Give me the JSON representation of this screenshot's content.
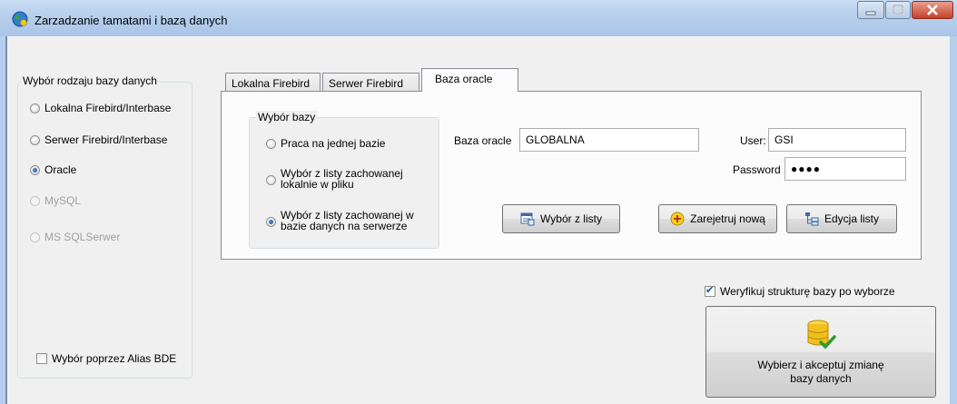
{
  "window": {
    "title": "Zarzadzanie tamatami i bazą danych",
    "controls": {
      "minimize": "minimize-icon",
      "maximize": "maximize-icon",
      "close": "close-icon"
    }
  },
  "db_type": {
    "group_title": "Wybór rodzaju bazy danych",
    "options": [
      {
        "label": "Lokalna Firebird/Interbase",
        "checked": false,
        "enabled": true
      },
      {
        "label": "Serwer Firebird/Interbase",
        "checked": false,
        "enabled": true
      },
      {
        "label": "Oracle",
        "checked": true,
        "enabled": true
      },
      {
        "label": "MySQL",
        "checked": false,
        "enabled": false
      },
      {
        "label": "MS SQLSerwer",
        "checked": false,
        "enabled": false
      }
    ],
    "alias_checkbox": {
      "label": "Wybór poprzez Alias BDE",
      "checked": false
    }
  },
  "tabs": [
    {
      "label": "Lokalna Firebird",
      "active": false
    },
    {
      "label": "Serwer Firebird",
      "active": false
    },
    {
      "label": "Baza oracle",
      "active": true
    }
  ],
  "oracle_tab": {
    "choice_group_title": "Wybór bazy",
    "choices": [
      {
        "label": "Praca na jednej bazie",
        "checked": false
      },
      {
        "label": "Wybór z listy zachowanej lokalnie w pliku",
        "checked": false
      },
      {
        "label": "Wybór z listy zachowanej w bazie danych na serwerze",
        "checked": true
      }
    ],
    "db_label": "Baza oracle",
    "db_value": "GLOBALNA",
    "user_label": "User:",
    "user_value": "GSI",
    "password_label": "Password",
    "password_value": "●●●●",
    "buttons": {
      "pick_from_list": "Wybór z listy",
      "register_new": "Zarejetruj nową",
      "edit_list": "Edycja listy"
    }
  },
  "verify": {
    "label": "Weryfikuj strukturę bazy po wyborze",
    "checked": true
  },
  "accept_button": {
    "line1": "Wybierz i akceptuj zmianę",
    "line2": "bazy danych"
  }
}
